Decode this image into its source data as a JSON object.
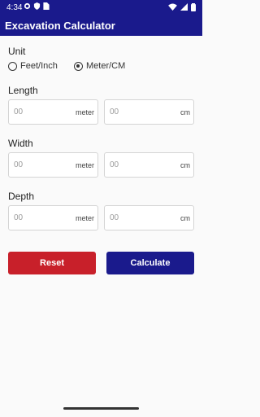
{
  "status": {
    "time": "4:34"
  },
  "app": {
    "title": "Excavation Calculator"
  },
  "unit": {
    "label": "Unit",
    "option1": "Feet/Inch",
    "option2": "Meter/CM",
    "selected": "Meter/CM"
  },
  "length": {
    "label": "Length",
    "meter_value": "00",
    "meter_unit": "meter",
    "cm_value": "00",
    "cm_unit": "cm"
  },
  "width": {
    "label": "Width",
    "meter_value": "00",
    "meter_unit": "meter",
    "cm_value": "00",
    "cm_unit": "cm"
  },
  "depth": {
    "label": "Depth",
    "meter_value": "00",
    "meter_unit": "meter",
    "cm_value": "00",
    "cm_unit": "cm"
  },
  "buttons": {
    "reset": "Reset",
    "calculate": "Calculate"
  },
  "colors": {
    "primary": "#1a1a8c",
    "reset": "#c8202a"
  }
}
